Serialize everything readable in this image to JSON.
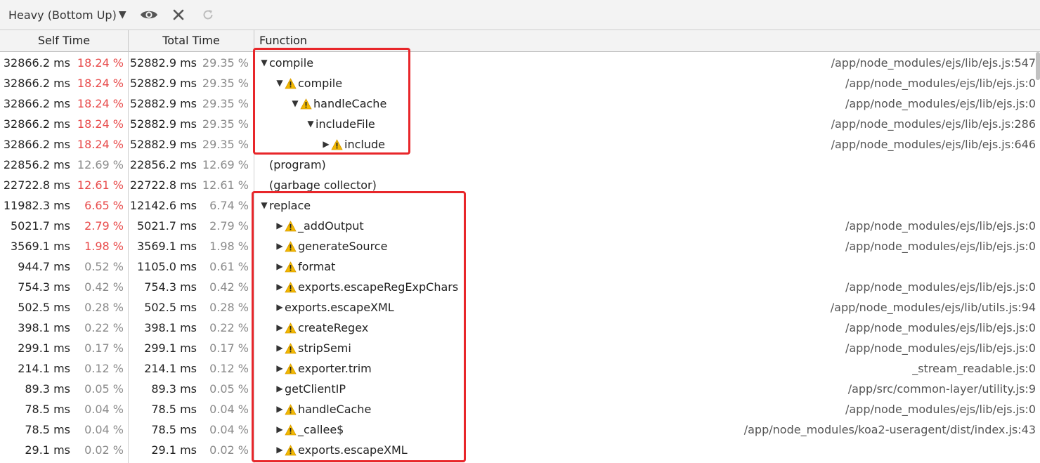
{
  "toolbar": {
    "view_mode": "Heavy (Bottom Up)",
    "icons": [
      "eye-icon",
      "close-icon",
      "refresh-icon"
    ]
  },
  "columns": {
    "self_time": "Self Time",
    "total_time": "Total Time",
    "function": "Function"
  },
  "colors": {
    "highlight": "#e8262a",
    "warning": "#f2b800",
    "hot_percent": "#e84a4a"
  },
  "rows": [
    {
      "self_ms": "32866.2 ms",
      "self_pct": "18.24 %",
      "total_ms": "52882.9 ms",
      "total_pct": "29.35 %",
      "name": "compile",
      "url": "/app/node_modules/ejs/lib/ejs.js:547",
      "level": 0,
      "expander": "expanded",
      "warning": false,
      "hot": true
    },
    {
      "self_ms": "32866.2 ms",
      "self_pct": "18.24 %",
      "total_ms": "52882.9 ms",
      "total_pct": "29.35 %",
      "name": "compile",
      "url": "/app/node_modules/ejs/lib/ejs.js:0",
      "level": 1,
      "expander": "expanded",
      "warning": true,
      "hot": true
    },
    {
      "self_ms": "32866.2 ms",
      "self_pct": "18.24 %",
      "total_ms": "52882.9 ms",
      "total_pct": "29.35 %",
      "name": "handleCache",
      "url": "/app/node_modules/ejs/lib/ejs.js:0",
      "level": 2,
      "expander": "expanded",
      "warning": true,
      "hot": true
    },
    {
      "self_ms": "32866.2 ms",
      "self_pct": "18.24 %",
      "total_ms": "52882.9 ms",
      "total_pct": "29.35 %",
      "name": "includeFile",
      "url": "/app/node_modules/ejs/lib/ejs.js:286",
      "level": 3,
      "expander": "expanded",
      "warning": false,
      "hot": true
    },
    {
      "self_ms": "32866.2 ms",
      "self_pct": "18.24 %",
      "total_ms": "52882.9 ms",
      "total_pct": "29.35 %",
      "name": "include",
      "url": "/app/node_modules/ejs/lib/ejs.js:646",
      "level": 4,
      "expander": "collapsed",
      "warning": true,
      "hot": true
    },
    {
      "self_ms": "22856.2 ms",
      "self_pct": "12.69 %",
      "total_ms": "22856.2 ms",
      "total_pct": "12.69 %",
      "name": "(program)",
      "url": "",
      "level": 0,
      "expander": "none",
      "warning": false,
      "hot": false
    },
    {
      "self_ms": "22722.8 ms",
      "self_pct": "12.61 %",
      "total_ms": "22722.8 ms",
      "total_pct": "12.61 %",
      "name": "(garbage collector)",
      "url": "",
      "level": 0,
      "expander": "none",
      "warning": false,
      "hot": true
    },
    {
      "self_ms": "11982.3 ms",
      "self_pct": "6.65 %",
      "total_ms": "12142.6 ms",
      "total_pct": "6.74 %",
      "name": "replace",
      "url": "",
      "level": 0,
      "expander": "expanded",
      "warning": false,
      "hot": true
    },
    {
      "self_ms": "5021.7 ms",
      "self_pct": "2.79 %",
      "total_ms": "5021.7 ms",
      "total_pct": "2.79 %",
      "name": "_addOutput",
      "url": "/app/node_modules/ejs/lib/ejs.js:0",
      "level": 1,
      "expander": "collapsed",
      "warning": true,
      "hot": true
    },
    {
      "self_ms": "3569.1 ms",
      "self_pct": "1.98 %",
      "total_ms": "3569.1 ms",
      "total_pct": "1.98 %",
      "name": "generateSource",
      "url": "/app/node_modules/ejs/lib/ejs.js:0",
      "level": 1,
      "expander": "collapsed",
      "warning": true,
      "hot": true
    },
    {
      "self_ms": "944.7 ms",
      "self_pct": "0.52 %",
      "total_ms": "1105.0 ms",
      "total_pct": "0.61 %",
      "name": "format",
      "url": "",
      "level": 1,
      "expander": "collapsed",
      "warning": true,
      "hot": false
    },
    {
      "self_ms": "754.3 ms",
      "self_pct": "0.42 %",
      "total_ms": "754.3 ms",
      "total_pct": "0.42 %",
      "name": "exports.escapeRegExpChars",
      "url": "/app/node_modules/ejs/lib/ejs.js:0",
      "level": 1,
      "expander": "collapsed",
      "warning": true,
      "hot": false
    },
    {
      "self_ms": "502.5 ms",
      "self_pct": "0.28 %",
      "total_ms": "502.5 ms",
      "total_pct": "0.28 %",
      "name": "exports.escapeXML",
      "url": "/app/node_modules/ejs/lib/utils.js:94",
      "level": 1,
      "expander": "collapsed",
      "warning": false,
      "hot": false
    },
    {
      "self_ms": "398.1 ms",
      "self_pct": "0.22 %",
      "total_ms": "398.1 ms",
      "total_pct": "0.22 %",
      "name": "createRegex",
      "url": "/app/node_modules/ejs/lib/ejs.js:0",
      "level": 1,
      "expander": "collapsed",
      "warning": true,
      "hot": false
    },
    {
      "self_ms": "299.1 ms",
      "self_pct": "0.17 %",
      "total_ms": "299.1 ms",
      "total_pct": "0.17 %",
      "name": "stripSemi",
      "url": "/app/node_modules/ejs/lib/ejs.js:0",
      "level": 1,
      "expander": "collapsed",
      "warning": true,
      "hot": false
    },
    {
      "self_ms": "214.1 ms",
      "self_pct": "0.12 %",
      "total_ms": "214.1 ms",
      "total_pct": "0.12 %",
      "name": "exporter.trim",
      "url": "_stream_readable.js:0",
      "level": 1,
      "expander": "collapsed",
      "warning": true,
      "hot": false
    },
    {
      "self_ms": "89.3 ms",
      "self_pct": "0.05 %",
      "total_ms": "89.3 ms",
      "total_pct": "0.05 %",
      "name": "getClientIP",
      "url": "/app/src/common-layer/utility.js:9",
      "level": 1,
      "expander": "collapsed",
      "warning": false,
      "hot": false
    },
    {
      "self_ms": "78.5 ms",
      "self_pct": "0.04 %",
      "total_ms": "78.5 ms",
      "total_pct": "0.04 %",
      "name": "handleCache",
      "url": "/app/node_modules/ejs/lib/ejs.js:0",
      "level": 1,
      "expander": "collapsed",
      "warning": true,
      "hot": false
    },
    {
      "self_ms": "78.5 ms",
      "self_pct": "0.04 %",
      "total_ms": "78.5 ms",
      "total_pct": "0.04 %",
      "name": "_callee$",
      "url": "/app/node_modules/koa2-useragent/dist/index.js:43",
      "level": 1,
      "expander": "collapsed",
      "warning": true,
      "hot": false
    },
    {
      "self_ms": "29.1 ms",
      "self_pct": "0.02 %",
      "total_ms": "29.1 ms",
      "total_pct": "0.02 %",
      "name": "exports.escapeXML",
      "url": "",
      "level": 1,
      "expander": "collapsed",
      "warning": true,
      "hot": false
    }
  ]
}
